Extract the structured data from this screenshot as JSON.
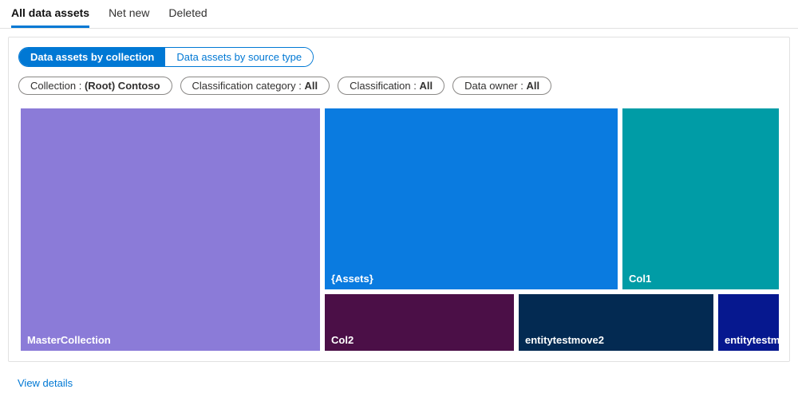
{
  "tabs": [
    {
      "label": "All data assets",
      "active": true
    },
    {
      "label": "Net new",
      "active": false
    },
    {
      "label": "Deleted",
      "active": false
    }
  ],
  "segments": [
    {
      "label": "Data assets by collection",
      "active": true
    },
    {
      "label": "Data assets by source type",
      "active": false
    }
  ],
  "filters": [
    {
      "label": "Collection",
      "value": "(Root) Contoso"
    },
    {
      "label": "Classification category",
      "value": "All"
    },
    {
      "label": "Classification",
      "value": "All"
    },
    {
      "label": "Data owner",
      "value": "All"
    }
  ],
  "chart_data": {
    "type": "treemap",
    "title": "Data assets by collection",
    "series": [
      {
        "name": "MasterCollection",
        "value": 38,
        "color": "#8b7bd8"
      },
      {
        "name": "{Assets}",
        "value": 27,
        "color": "#0a7be0"
      },
      {
        "name": "Col1",
        "value": 14,
        "color": "#009ca6"
      },
      {
        "name": "Col2",
        "value": 8,
        "color": "#4b0f47"
      },
      {
        "name": "entitytestmove2",
        "value": 8,
        "color": "#032a52"
      },
      {
        "name": "entitytestmov...",
        "value": 3,
        "color": "#06188f"
      }
    ]
  },
  "view_details": "View details"
}
